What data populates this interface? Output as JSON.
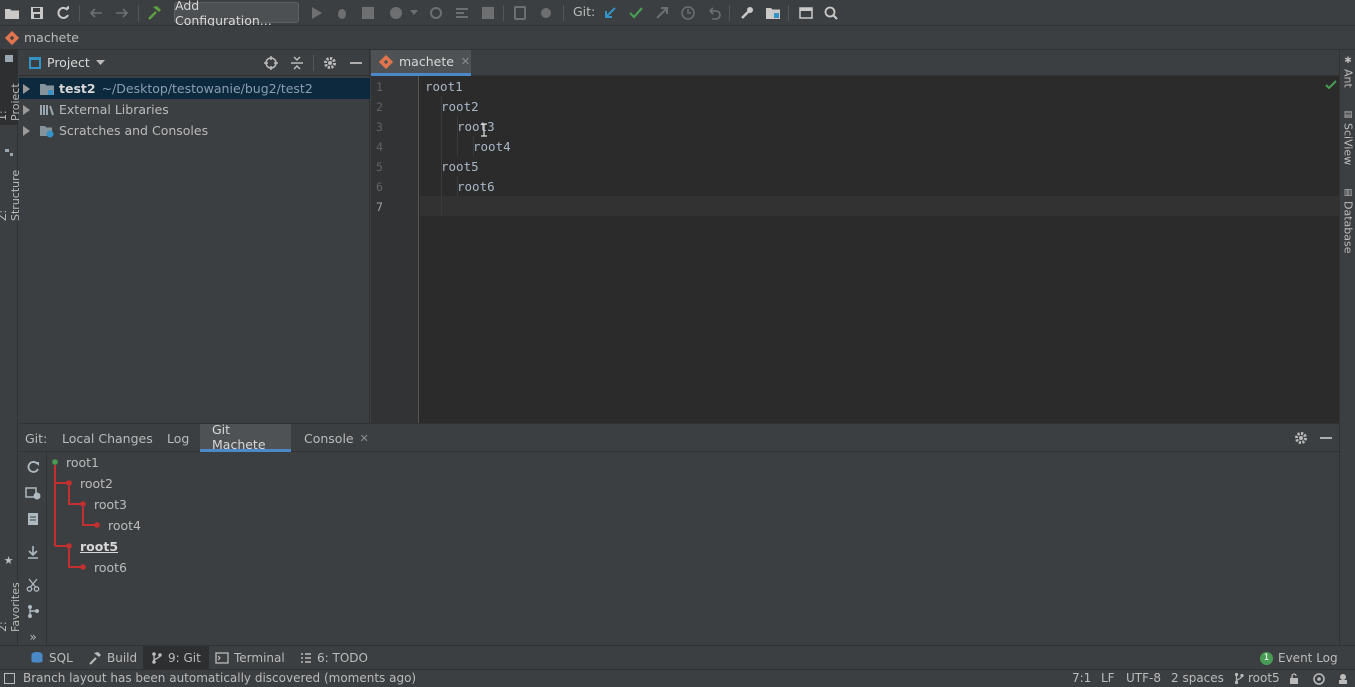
{
  "toolbar": {
    "add_configuration_label": "Add Configuration...",
    "git_label": "Git:"
  },
  "navbar": {
    "file_name": "machete"
  },
  "left_stripe": {
    "project_tab": "1: Project",
    "structure_tab": "Z: Structure",
    "favorites_tab": "2: Favorites"
  },
  "right_stripe": {
    "tabs": [
      "Ant",
      "SciView",
      "Database"
    ]
  },
  "project_panel": {
    "view_label": "Project",
    "tree": [
      {
        "name": "test2",
        "path": "~/Desktop/testowanie/bug2/test2"
      },
      {
        "name": "External Libraries"
      },
      {
        "name": "Scratches and Consoles"
      }
    ]
  },
  "editor": {
    "tab_label": "machete",
    "line_numbers": [
      "1",
      "2",
      "3",
      "4",
      "5",
      "6",
      "7"
    ],
    "lines": [
      "root1",
      "root2",
      "root3",
      "root4",
      "root5",
      "root6",
      ""
    ]
  },
  "git_panel": {
    "prefix": "Git:",
    "tabs": [
      "Local Changes",
      "Log",
      "Git Machete",
      "Console"
    ],
    "active_tab": "Git Machete",
    "branches": [
      "root1",
      "root2",
      "root3",
      "root4",
      "root5",
      "root6"
    ],
    "current_branch": "root5"
  },
  "bottom_stripe": {
    "tabs": [
      "SQL",
      "Build",
      "9: Git",
      "Terminal",
      "6: TODO"
    ],
    "event_log": "Event Log",
    "event_log_count": "1"
  },
  "status_bar": {
    "message": "Branch layout has been automatically discovered (moments ago)",
    "position": "7:1",
    "line_separator": "LF",
    "encoding": "UTF-8",
    "indent": "2 spaces",
    "branch": "root5"
  },
  "colors": {
    "accent": "#4a88c7",
    "git_green": "#499c54",
    "machete_red": "#c43030",
    "selection": "#0d293e"
  }
}
